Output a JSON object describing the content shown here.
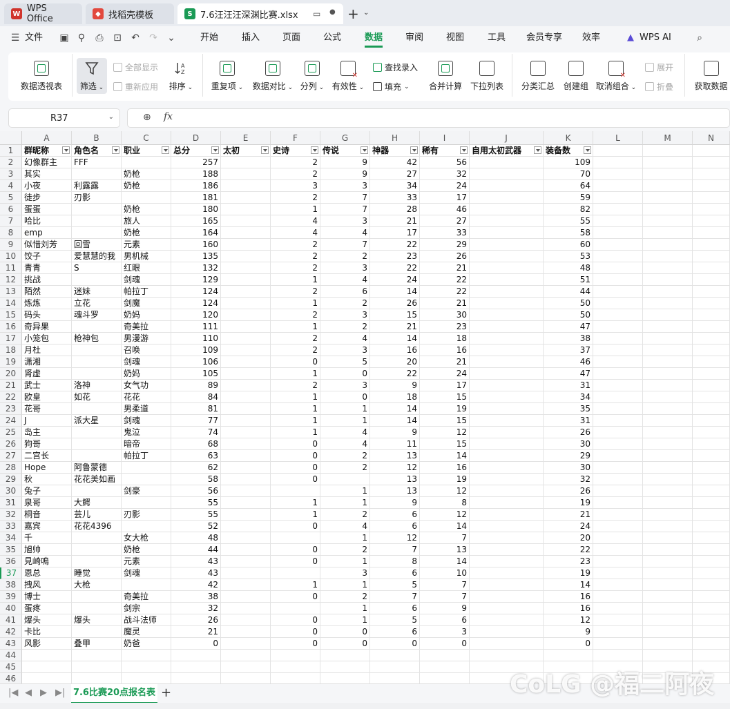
{
  "tabs": [
    {
      "label": "WPS Office",
      "icon": "wps-logo-icon"
    },
    {
      "label": "找稻壳模板",
      "icon": "docer-icon"
    },
    {
      "label": "7.6汪汪汪深渊比赛.xlsx",
      "icon": "spreadsheet-s-icon"
    }
  ],
  "menu": {
    "file": "文件",
    "items": [
      "开始",
      "插入",
      "页面",
      "公式",
      "数据",
      "审阅",
      "视图",
      "工具",
      "会员专享",
      "效率"
    ],
    "active": "数据",
    "ai": "WPS AI"
  },
  "ribbon": {
    "pivot": "数据透视表",
    "filter": "筛选",
    "show_all": "全部显示",
    "reapply": "重新应用",
    "sort": "排序",
    "duplicates": "重复项",
    "compare": "数据对比",
    "split": "分列",
    "validity": "有效性",
    "lookup": "查找录入",
    "fill": "填充",
    "consolidate": "合并计算",
    "dropdown": "下拉列表",
    "subtotal": "分类汇总",
    "group": "创建组",
    "ungroup": "取消组合",
    "expand": "展开",
    "collapse": "折叠",
    "get_data": "获取数据"
  },
  "formula_bar": {
    "name_box": "R37",
    "fx": "fx",
    "formula": ""
  },
  "columns": [
    "A",
    "B",
    "C",
    "D",
    "E",
    "F",
    "G",
    "H",
    "I",
    "J",
    "K",
    "L",
    "M",
    "N"
  ],
  "headers": [
    "群昵称",
    "角色名",
    "职业",
    "总分",
    "太初",
    "史诗",
    "传说",
    "神器",
    "稀有",
    "自用太初武器",
    "装备数"
  ],
  "rows": [
    [
      "幻像群主",
      "FFF",
      "",
      "257",
      "",
      "2",
      "9",
      "42",
      "56",
      "",
      "109"
    ],
    [
      "其实",
      "",
      "奶枪",
      "188",
      "",
      "2",
      "9",
      "27",
      "32",
      "",
      "70"
    ],
    [
      "小夜",
      "利露露",
      "奶枪",
      "186",
      "",
      "3",
      "3",
      "34",
      "24",
      "",
      "64"
    ],
    [
      "徒步",
      "刃影",
      "",
      "181",
      "",
      "2",
      "7",
      "33",
      "17",
      "",
      "59"
    ],
    [
      "蛋蛋",
      "",
      "奶枪",
      "180",
      "",
      "1",
      "7",
      "28",
      "46",
      "",
      "82"
    ],
    [
      "哈比",
      "",
      "旅人",
      "165",
      "",
      "4",
      "3",
      "21",
      "27",
      "",
      "55"
    ],
    [
      "emp",
      "",
      "奶枪",
      "164",
      "",
      "4",
      "4",
      "17",
      "33",
      "",
      "58"
    ],
    [
      "似惜刘芳",
      "回雪",
      "元素",
      "160",
      "",
      "2",
      "7",
      "22",
      "29",
      "",
      "60"
    ],
    [
      "饺子",
      "爱慧慧的我",
      "男机械",
      "135",
      "",
      "2",
      "2",
      "23",
      "26",
      "",
      "53"
    ],
    [
      "青青",
      "S",
      "红眼",
      "132",
      "",
      "2",
      "3",
      "22",
      "21",
      "",
      "48"
    ],
    [
      "挑战",
      "",
      "剑魂",
      "129",
      "",
      "1",
      "4",
      "24",
      "22",
      "",
      "51"
    ],
    [
      "陌然",
      "迷妹",
      "帕拉丁",
      "124",
      "",
      "2",
      "6",
      "14",
      "22",
      "",
      "44"
    ],
    [
      "炼炼",
      "立花",
      "剑魔",
      "124",
      "",
      "1",
      "2",
      "26",
      "21",
      "",
      "50"
    ],
    [
      "码头",
      "魂斗罗",
      "奶妈",
      "120",
      "",
      "2",
      "3",
      "15",
      "30",
      "",
      "50"
    ],
    [
      "奇异果",
      "",
      "奇美拉",
      "111",
      "",
      "1",
      "2",
      "21",
      "23",
      "",
      "47"
    ],
    [
      "小笼包",
      "枪神包",
      "男漫游",
      "110",
      "",
      "2",
      "4",
      "14",
      "18",
      "",
      "38"
    ],
    [
      "月杜",
      "",
      "召唤",
      "109",
      "",
      "2",
      "3",
      "16",
      "16",
      "",
      "37"
    ],
    [
      "潇湘",
      "",
      "剑魂",
      "106",
      "",
      "0",
      "5",
      "20",
      "21",
      "",
      "46"
    ],
    [
      "肾虚",
      "",
      "奶妈",
      "105",
      "",
      "1",
      "0",
      "22",
      "24",
      "",
      "47"
    ],
    [
      "武士",
      "洛神",
      "女气功",
      "89",
      "",
      "2",
      "3",
      "9",
      "17",
      "",
      "31"
    ],
    [
      "欧皇",
      "如花",
      "花花",
      "84",
      "",
      "1",
      "0",
      "18",
      "15",
      "",
      "34"
    ],
    [
      "花哥",
      "",
      "男柔道",
      "81",
      "",
      "1",
      "1",
      "14",
      "19",
      "",
      "35"
    ],
    [
      "J",
      "派大星",
      "剑魂",
      "77",
      "",
      "1",
      "1",
      "14",
      "15",
      "",
      "31"
    ],
    [
      "岛主",
      "",
      "鬼泣",
      "74",
      "",
      "1",
      "4",
      "9",
      "12",
      "",
      "26"
    ],
    [
      "狗哥",
      "",
      "暗帝",
      "68",
      "",
      "0",
      "4",
      "11",
      "15",
      "",
      "30"
    ],
    [
      "二宫长",
      "",
      "帕拉丁",
      "63",
      "",
      "0",
      "2",
      "13",
      "14",
      "",
      "29"
    ],
    [
      "Hope",
      "阿鲁蒙德",
      "",
      "62",
      "",
      "0",
      "2",
      "12",
      "16",
      "",
      "30"
    ],
    [
      "秋",
      "花花美如画",
      "",
      "58",
      "",
      "0",
      "",
      "13",
      "19",
      "",
      "32"
    ],
    [
      "兔子",
      "",
      "剑豪",
      "56",
      "",
      "",
      "1",
      "13",
      "12",
      "",
      "26"
    ],
    [
      "泉哥",
      "大鳄",
      "",
      "55",
      "",
      "1",
      "1",
      "9",
      "8",
      "",
      "19"
    ],
    [
      "桐音",
      "芸儿",
      "刃影",
      "55",
      "",
      "1",
      "2",
      "6",
      "12",
      "",
      "21"
    ],
    [
      "嘉宾",
      "花花4396",
      "",
      "52",
      "",
      "0",
      "4",
      "6",
      "14",
      "",
      "24"
    ],
    [
      "千",
      "",
      "女大枪",
      "48",
      "",
      "",
      "1",
      "12",
      "7",
      "",
      "20"
    ],
    [
      "旭帅",
      "",
      "奶枪",
      "44",
      "",
      "0",
      "2",
      "7",
      "13",
      "",
      "22"
    ],
    [
      "見崎鳴",
      "",
      "元素",
      "43",
      "",
      "0",
      "1",
      "8",
      "14",
      "",
      "23"
    ],
    [
      "恩总",
      "睡觉",
      "剑魂",
      "43",
      "",
      "",
      "3",
      "6",
      "10",
      "",
      "19"
    ],
    [
      "拽风",
      "大枪",
      "",
      "42",
      "",
      "1",
      "1",
      "5",
      "7",
      "",
      "14"
    ],
    [
      "博士",
      "",
      "奇美拉",
      "38",
      "",
      "0",
      "2",
      "7",
      "7",
      "",
      "16"
    ],
    [
      "蛋疼",
      "",
      "剑宗",
      "32",
      "",
      "",
      "1",
      "6",
      "9",
      "",
      "16"
    ],
    [
      "爆头",
      "爆头",
      "战斗法师",
      "26",
      "",
      "0",
      "1",
      "5",
      "6",
      "",
      "12"
    ],
    [
      "卡比",
      "",
      "魔灵",
      "21",
      "",
      "0",
      "0",
      "6",
      "3",
      "",
      "9"
    ],
    [
      "风影",
      "叠甲",
      "奶爸",
      "0",
      "",
      "0",
      "0",
      "0",
      "0",
      "",
      "0"
    ]
  ],
  "row_numbers": [
    "1",
    "2",
    "3",
    "4",
    "5",
    "6",
    "7",
    "8",
    "9",
    "10",
    "11",
    "12",
    "13",
    "14",
    "15",
    "16",
    "17",
    "18",
    "19",
    "20",
    "21",
    "22",
    "23",
    "24",
    "25",
    "26",
    "27",
    "28",
    "29",
    "30",
    "31",
    "32",
    "33",
    "34",
    "35",
    "36",
    "37",
    "38",
    "39",
    "40",
    "41",
    "42",
    "43",
    "44",
    "45",
    "46"
  ],
  "selected_row": "37",
  "sheet_tab": "7.6比赛20点报名表",
  "watermark": "CoLG @福二阿夜",
  "colors": {
    "accent": "#1a9a55",
    "tab_bg": "#e9ecf1"
  }
}
